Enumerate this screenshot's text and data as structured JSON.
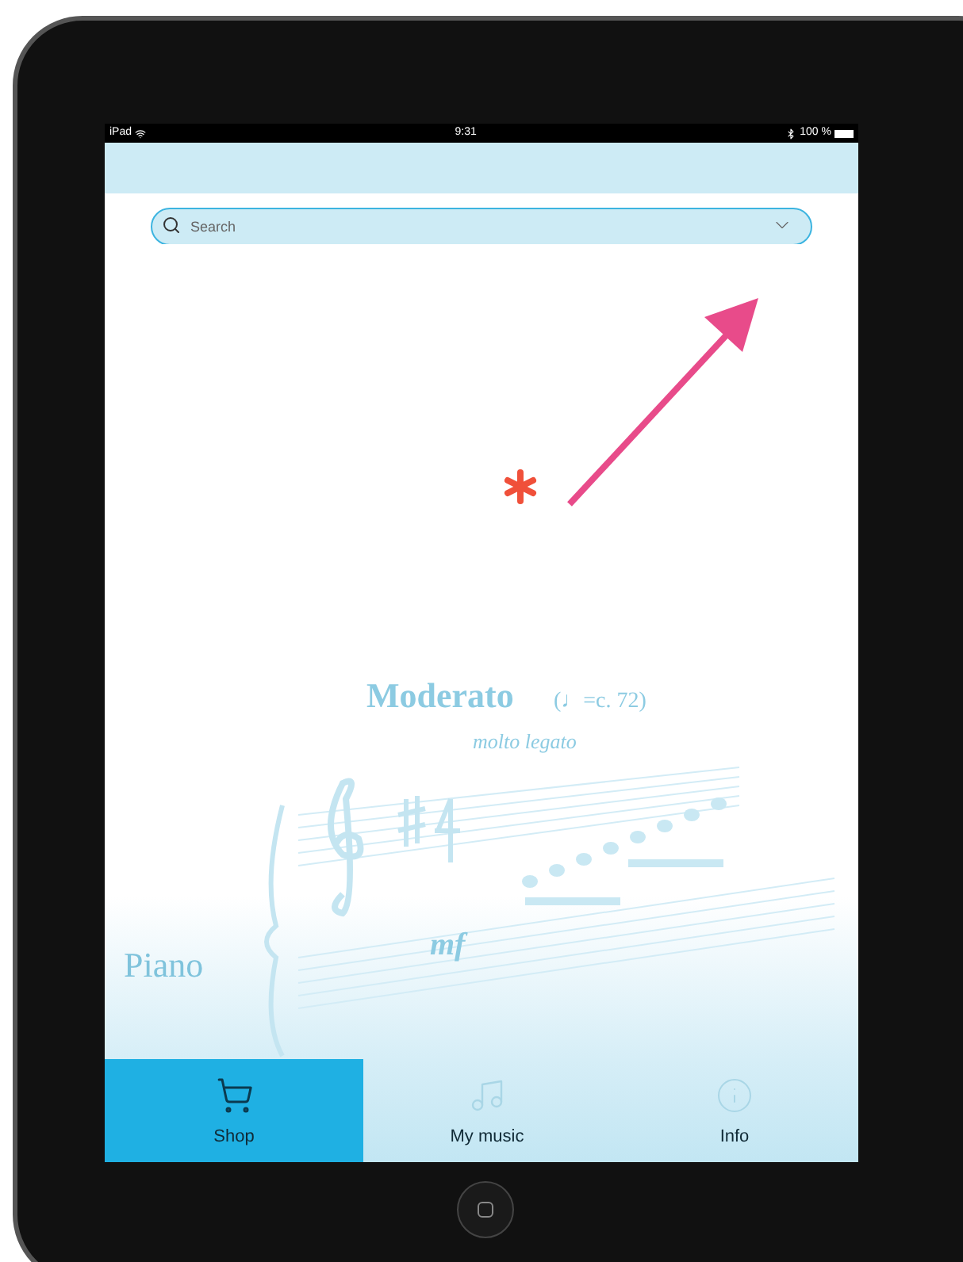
{
  "status_bar": {
    "device": "iPad",
    "time": "9:31",
    "battery": "100 %"
  },
  "search": {
    "placeholder": "Search"
  },
  "background_art": {
    "tempo_marking": "Moderato",
    "metronome": "(♩=c. 72)",
    "expression": "molto legato",
    "dynamic": "mf",
    "instrument": "Piano"
  },
  "tabs": [
    {
      "label": "Shop",
      "kind": "cart",
      "selected": true
    },
    {
      "label": "My music",
      "kind": "music",
      "selected": false
    },
    {
      "label": "Info",
      "kind": "info",
      "selected": false
    }
  ]
}
